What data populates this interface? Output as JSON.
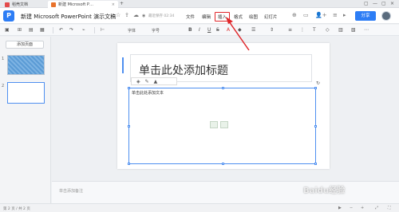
{
  "tabs": [
    {
      "label": "稻壳文档"
    },
    {
      "label": "新建 Microsoft P…",
      "close": "×"
    }
  ],
  "window_controls": [
    "▢",
    "—",
    "▢",
    "×"
  ],
  "title": {
    "doc_title": "新建 Microsoft PowerPoint 演示文稿",
    "app_logo": "P",
    "saved_text": "最近保存 02:34",
    "menus": [
      "文件",
      "编辑",
      "插入",
      "格式",
      "绘图",
      "幻灯片"
    ],
    "highlighted_menu": "插入",
    "share_label": "分享"
  },
  "toolbar": {
    "font_name": "字体",
    "font_size": "字号",
    "icons": [
      "layout-icon",
      "grid-icon",
      "undo-icon",
      "redo-icon",
      "format-painter-icon",
      "align-icon",
      "bold-icon",
      "italic-icon",
      "underline-icon",
      "strikethrough-icon",
      "font-color-icon",
      "highlight-icon",
      "list-icon",
      "line-spacing-icon",
      "text-align-icon",
      "more-icon"
    ]
  },
  "sidebar": {
    "layout_button": "添加页面",
    "slide_numbers": [
      "1",
      "2"
    ]
  },
  "slide": {
    "title_placeholder": "单击此处添加标题",
    "body_placeholder": "单击此处添加文本"
  },
  "notes": {
    "placeholder": "单击添加备注"
  },
  "status": {
    "page_info": "第 2 页 / 共 2 页"
  },
  "watermark": "Baidu经验",
  "colors": {
    "accent": "#2d7df5",
    "highlight_box": "#e0262a"
  }
}
